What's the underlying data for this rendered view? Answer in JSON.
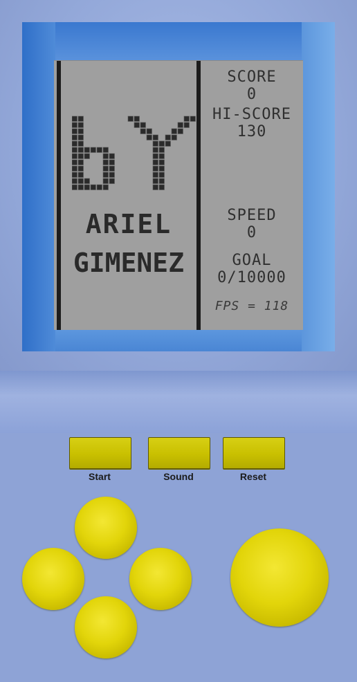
{
  "screen": {
    "score_label": "SCORE",
    "score_value": "0",
    "hiscore_label": "HI-SCORE",
    "hiscore_value": "130",
    "speed_label": "SPEED",
    "speed_value": "0",
    "goal_label": "GOAL",
    "goal_value": "0/10000",
    "fps_text": "FPS = 118",
    "splash_logo_text": "bY",
    "author_line1": "ARIEL",
    "author_line2": "GIMENEZ"
  },
  "controls": {
    "start_label": "Start",
    "sound_label": "Sound",
    "reset_label": "Reset",
    "dpad_icons": [
      "up-button",
      "left-button",
      "right-button",
      "down-button"
    ],
    "action_icon": "rotate-button"
  },
  "colors": {
    "shell": "#8fa4d4",
    "bezel": "#4a86d4",
    "lcd": "#9f9f9f",
    "button_yellow": "#d7cf14"
  }
}
